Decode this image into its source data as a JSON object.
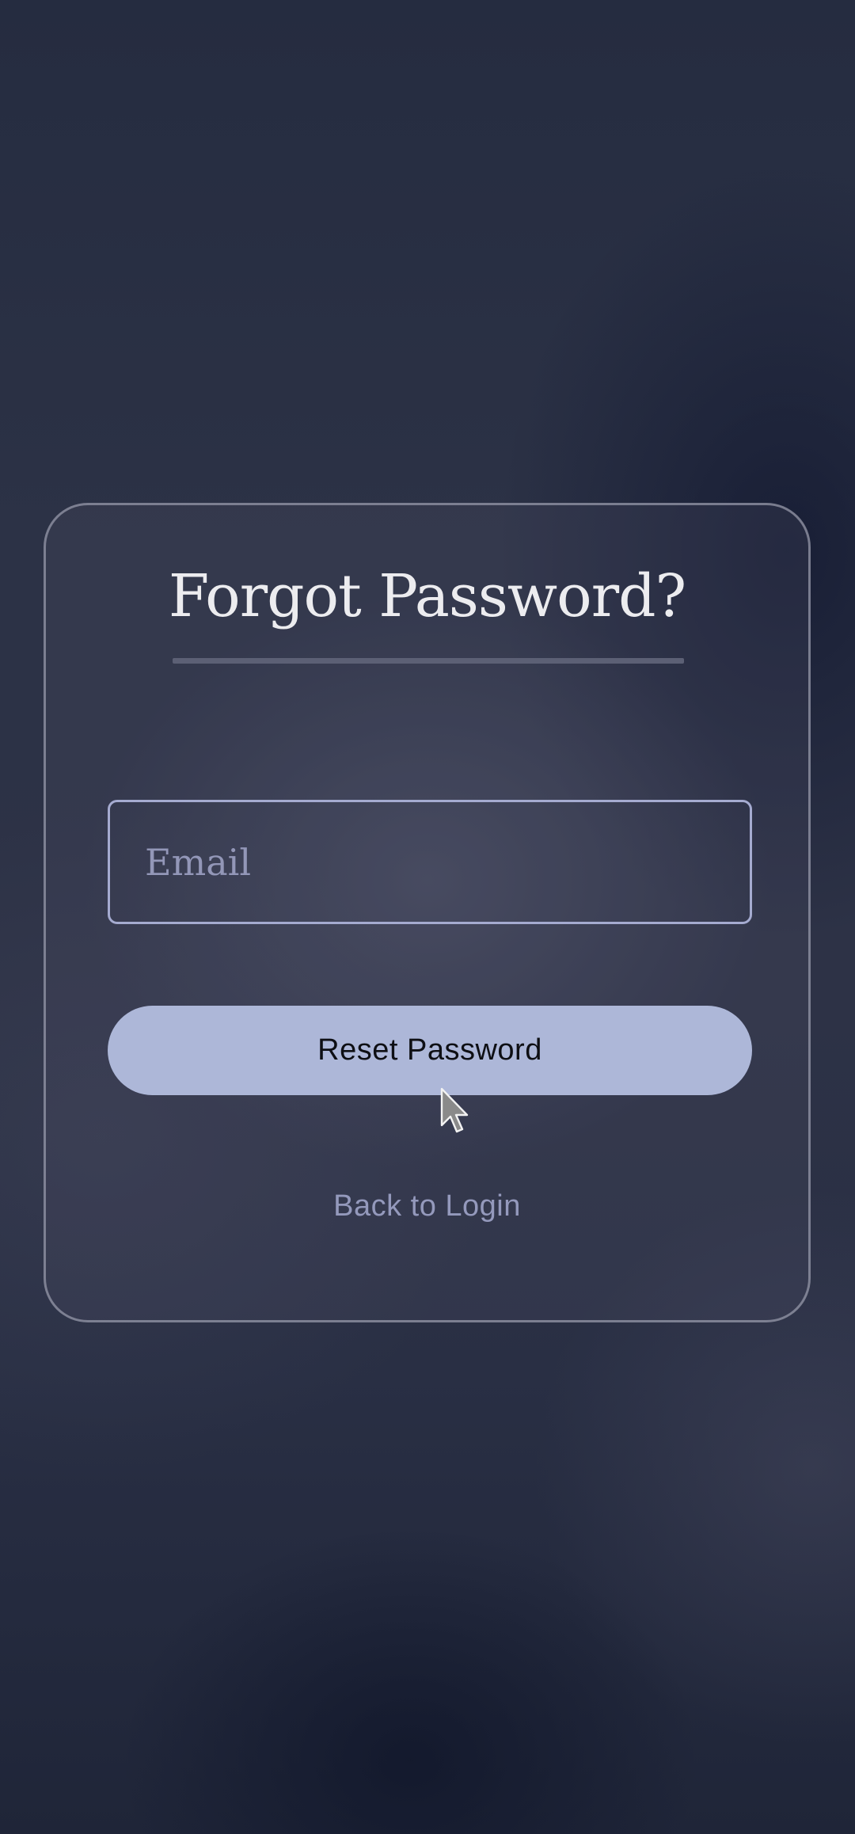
{
  "forgot_password_form": {
    "title": "Forgot Password?",
    "email": {
      "value": "",
      "placeholder": "Email"
    },
    "reset_button_label": "Reset Password",
    "back_link_label": "Back to Login"
  },
  "colors": {
    "accent_button": "#adb7d8",
    "field_border": "#a5abd0",
    "link": "#9499bc",
    "title": "#ececef"
  },
  "icons": {
    "cursor": "mouse-pointer-icon"
  }
}
